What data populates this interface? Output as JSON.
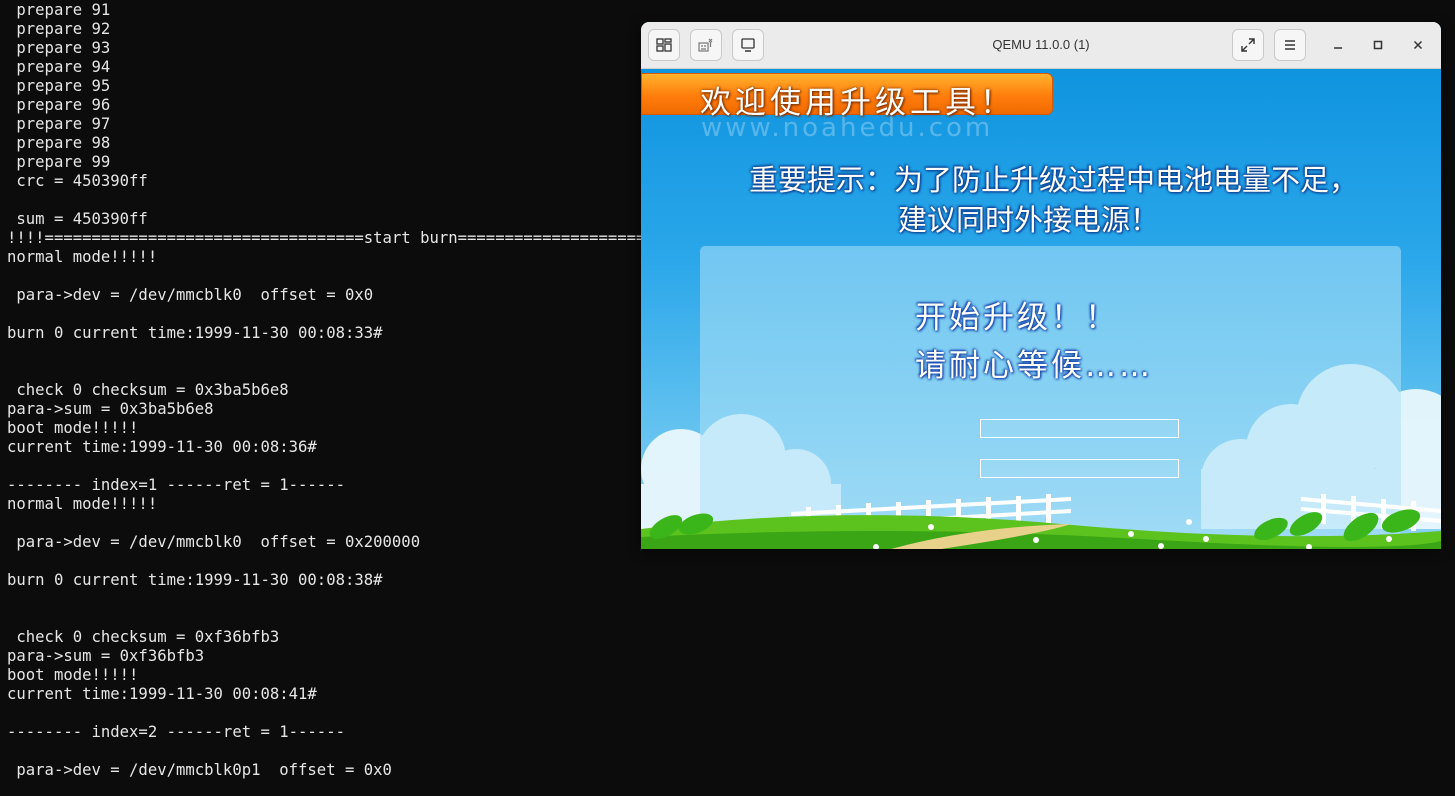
{
  "terminal": {
    "lines": [
      " prepare 91",
      " prepare 92",
      " prepare 93",
      " prepare 94",
      " prepare 95",
      " prepare 96",
      " prepare 97",
      " prepare 98",
      " prepare 99",
      " crc = 450390ff",
      "",
      " sum = 450390ff",
      "!!!!==================================start burn======================",
      "normal mode!!!!!",
      "",
      " para->dev = /dev/mmcblk0  offset = 0x0",
      "",
      "burn 0 current time:1999-11-30 00:08:33#",
      "",
      "",
      " check 0 checksum = 0x3ba5b6e8",
      "para->sum = 0x3ba5b6e8",
      "boot mode!!!!!",
      "current time:1999-11-30 00:08:36#",
      "",
      "-------- index=1 ------ret = 1------",
      "normal mode!!!!!",
      "",
      " para->dev = /dev/mmcblk0  offset = 0x200000",
      "",
      "burn 0 current time:1999-11-30 00:08:38#",
      "",
      "",
      " check 0 checksum = 0xf36bfb3",
      "para->sum = 0xf36bfb3",
      "boot mode!!!!!",
      "current time:1999-11-30 00:08:41#",
      "",
      "-------- index=2 ------ret = 1------",
      "",
      " para->dev = /dev/mmcblk0p1  offset = 0x0"
    ]
  },
  "qemu": {
    "title": "QEMU 11.0.0 (1)",
    "toolbar_icons": [
      "views-icon",
      "keyboard-grab-icon",
      "display-icon"
    ],
    "screen": {
      "banner": "欢迎使用升级工具！",
      "watermark": "www.noahedu.com",
      "notice_line1": "重要提示：为了防止升级过程中电池电量不足，",
      "notice_line2": "建议同时外接电源！",
      "status_line1": "开始升级！！",
      "status_line2": "请耐心等候……",
      "progress": [
        0,
        0
      ]
    }
  }
}
